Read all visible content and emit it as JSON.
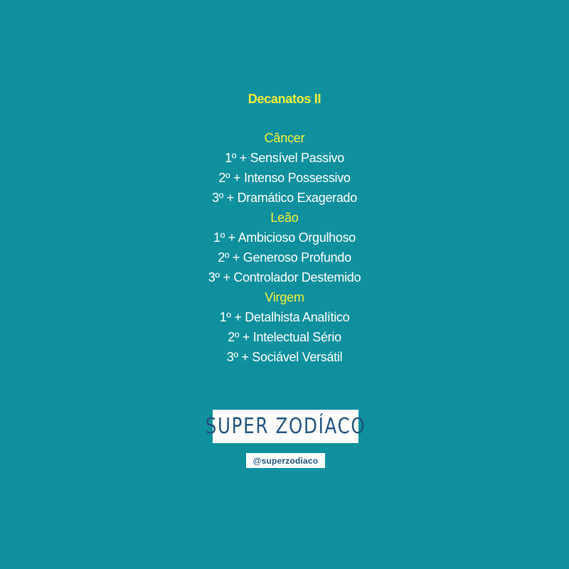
{
  "title": "Decanatos II",
  "groups": [
    {
      "sign": "Câncer",
      "items": [
        "1º + Sensível Passivo",
        "2º + Intenso Possessivo",
        "3º + Dramático Exagerado"
      ]
    },
    {
      "sign": "Leão",
      "items": [
        "1º + Ambicioso Orgulhoso",
        "2º + Generoso Profundo",
        "3º + Controlador Destemido"
      ]
    },
    {
      "sign": "Virgem",
      "items": [
        "1º + Detalhista Analítico",
        "2º + Intelectual Sério",
        "3º + Sociável Versátil"
      ]
    }
  ],
  "brand": {
    "logo": "SUPER ZODÍACO",
    "handle": "@superzodiaco"
  },
  "colors": {
    "background": "#0e909f",
    "accent": "#f4f13a",
    "text": "#ffffff",
    "brand": "#21527f"
  }
}
